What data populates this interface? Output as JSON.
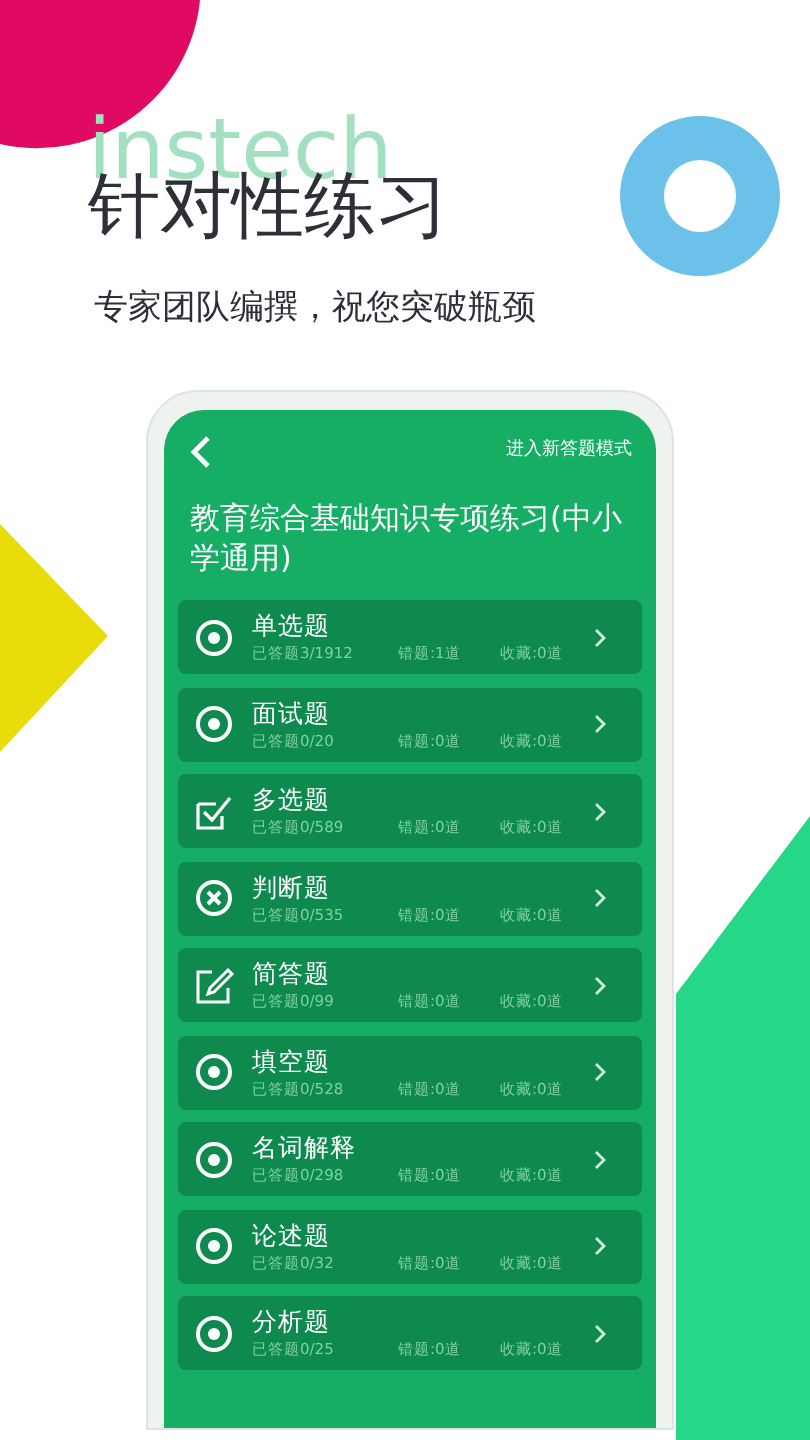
{
  "backdrop_text": "instech",
  "headline": "针对性练习",
  "subtitle": "专家团队编撰，祝您突破瓶颈",
  "screen": {
    "top_link": "进入新答题模式",
    "title": "教育综合基础知识专项练习(中小学通用)",
    "items": [
      {
        "kind": "radio",
        "name": "单选题",
        "answered": "已答题3/1912",
        "wrong": "错题:1道",
        "saved": "收藏:0道"
      },
      {
        "kind": "radio",
        "name": "面试题",
        "answered": "已答题0/20",
        "wrong": "错题:0道",
        "saved": "收藏:0道"
      },
      {
        "kind": "check",
        "name": "多选题",
        "answered": "已答题0/589",
        "wrong": "错题:0道",
        "saved": "收藏:0道"
      },
      {
        "kind": "cross",
        "name": "判断题",
        "answered": "已答题0/535",
        "wrong": "错题:0道",
        "saved": "收藏:0道"
      },
      {
        "kind": "edit",
        "name": "简答题",
        "answered": "已答题0/99",
        "wrong": "错题:0道",
        "saved": "收藏:0道"
      },
      {
        "kind": "radio",
        "name": "填空题",
        "answered": "已答题0/528",
        "wrong": "错题:0道",
        "saved": "收藏:0道"
      },
      {
        "kind": "radio",
        "name": "名词解释",
        "answered": "已答题0/298",
        "wrong": "错题:0道",
        "saved": "收藏:0道"
      },
      {
        "kind": "radio",
        "name": "论述题",
        "answered": "已答题0/32",
        "wrong": "错题:0道",
        "saved": "收藏:0道"
      },
      {
        "kind": "radio",
        "name": "分析题",
        "answered": "已答题0/25",
        "wrong": "错题:0道",
        "saved": "收藏:0道"
      }
    ]
  }
}
